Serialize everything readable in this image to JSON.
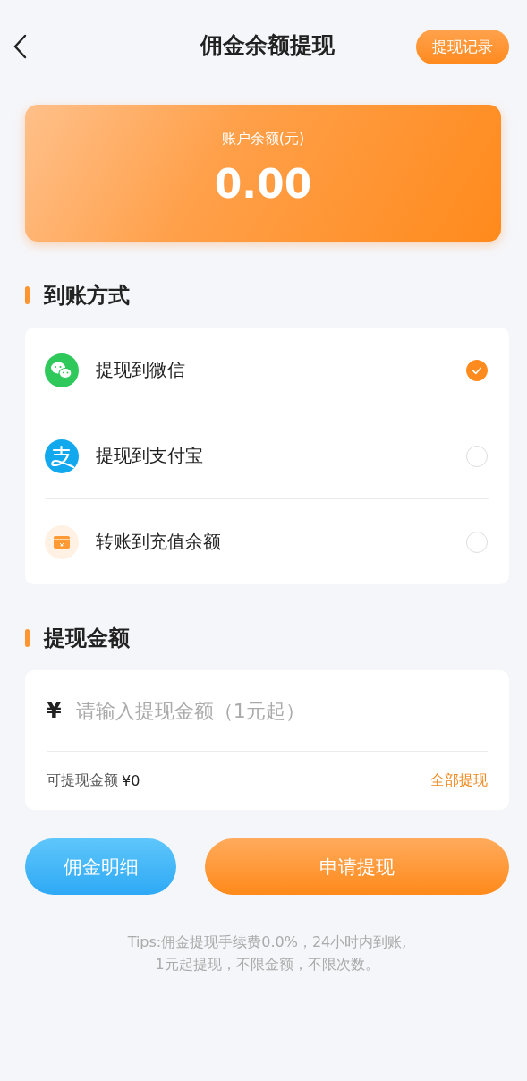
{
  "header": {
    "title": "佣金余额提现",
    "action": "提现记录"
  },
  "balance": {
    "label": "账户余额(元)",
    "amount": "0.00"
  },
  "methods_section": {
    "title": "到账方式"
  },
  "methods": [
    {
      "kind": "wechat",
      "label": "提现到微信",
      "selected": true
    },
    {
      "kind": "alipay",
      "label": "提现到支付宝",
      "selected": false
    },
    {
      "kind": "balance",
      "label": "转账到充值余额",
      "selected": false
    }
  ],
  "amount_section": {
    "title": "提现金额"
  },
  "amount": {
    "currency": "¥",
    "placeholder": "请输入提现金额（1元起）",
    "available_label": "可提现金额",
    "available_value": "¥0",
    "all_link": "全部提现"
  },
  "buttons": {
    "details": "佣金明细",
    "apply": "申请提现"
  },
  "tips": [
    "Tips:佣金提现手续费0.0%，24小时内到账,",
    "1元起提现，不限金额，不限次数。"
  ]
}
